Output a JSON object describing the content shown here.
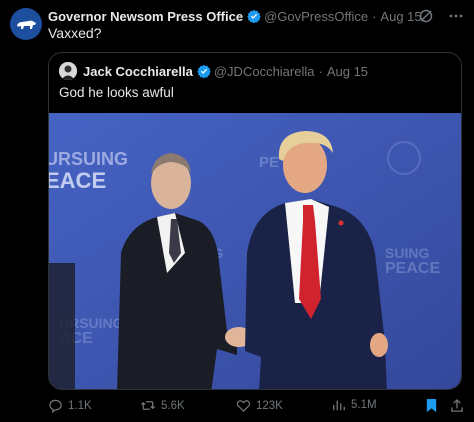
{
  "post": {
    "author_name": "Governor Newsom Press Office",
    "handle": "@GovPressOffice",
    "separator": "·",
    "date": "Aug 15",
    "text": "Vaxxed?",
    "avatar_icon": "bear-icon",
    "grok_icon": "grok-icon",
    "more_icon": "more-icon"
  },
  "quote": {
    "author_name": "Jack Cocchiarella",
    "handle": "@JDCocchiarella",
    "separator": "·",
    "date": "Aug 15",
    "text": "God he looks awful",
    "backdrop_lines": [
      "URSUING",
      "EACE"
    ]
  },
  "actions": {
    "replies": "1.1K",
    "reposts": "5.6K",
    "likes": "123K",
    "views": "5.1M"
  },
  "colors": {
    "verified": "#1d9bf0",
    "bookmark": "#1d9bf0",
    "avatar_bg": "#1d4f9e",
    "backdrop": "#3f57b4"
  }
}
